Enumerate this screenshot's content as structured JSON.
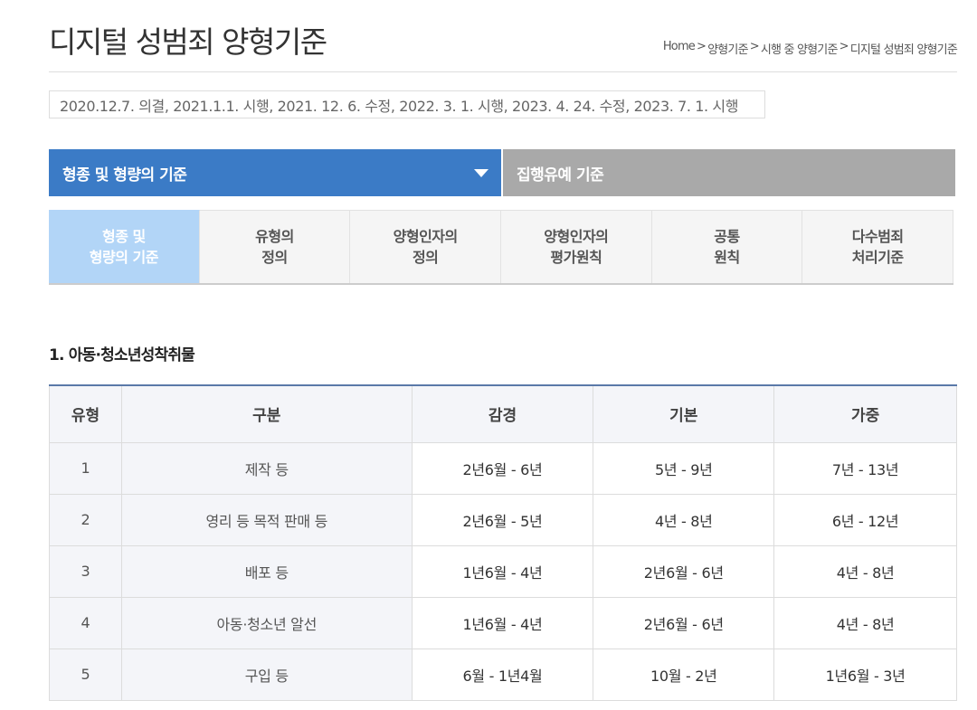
{
  "page": {
    "title": "디지털 성범죄 양형기준",
    "breadcrumb": [
      "Home",
      "양형기준",
      "시행 중 양형기준",
      "디지털 성범죄 양형기준"
    ],
    "breadcrumb_sep": ">",
    "history": "2020.12.7. 의결, 2021.1.1. 시행, 2021. 12. 6. 수정, 2022. 3. 1. 시행, 2023. 4. 24. 수정, 2023. 7. 1. 시행"
  },
  "main_tabs": [
    {
      "label": "형종 및 형량의 기준",
      "active": true
    },
    {
      "label": "집행유예 기준",
      "active": false
    }
  ],
  "sub_tabs": [
    {
      "line1": "형종 및",
      "line2": "형량의 기준",
      "active": true
    },
    {
      "line1": "유형의",
      "line2": "정의",
      "active": false
    },
    {
      "line1": "양형인자의",
      "line2": "정의",
      "active": false
    },
    {
      "line1": "양형인자의",
      "line2": "평가원칙",
      "active": false
    },
    {
      "line1": "공통",
      "line2": "원칙",
      "active": false
    },
    {
      "line1": "다수범죄",
      "line2": "처리기준",
      "active": false
    }
  ],
  "section": {
    "heading": "1. 아동·청소년성착취물"
  },
  "table": {
    "headers": [
      "유형",
      "구분",
      "감경",
      "기본",
      "가중"
    ],
    "rows": [
      [
        "1",
        "제작 등",
        "2년6월 - 6년",
        "5년 - 9년",
        "7년 - 13년"
      ],
      [
        "2",
        "영리 등 목적 판매 등",
        "2년6월 - 5년",
        "4년 - 8년",
        "6년 - 12년"
      ],
      [
        "3",
        "배포 등",
        "1년6월 - 4년",
        "2년6월 - 6년",
        "4년 - 8년"
      ],
      [
        "4",
        "아동·청소년 알선",
        "1년6월 - 4년",
        "2년6월 - 6년",
        "4년 - 8년"
      ],
      [
        "5",
        "구입 등",
        "6월 - 1년4월",
        "10월 - 2년",
        "1년6월 - 3년"
      ]
    ]
  },
  "colors": {
    "active_main_tab": "#3b7bc6",
    "inactive_main_tab": "#a9a9a9",
    "active_sub_tab": "#b2d5f7",
    "table_top_border": "#5a79a8"
  }
}
